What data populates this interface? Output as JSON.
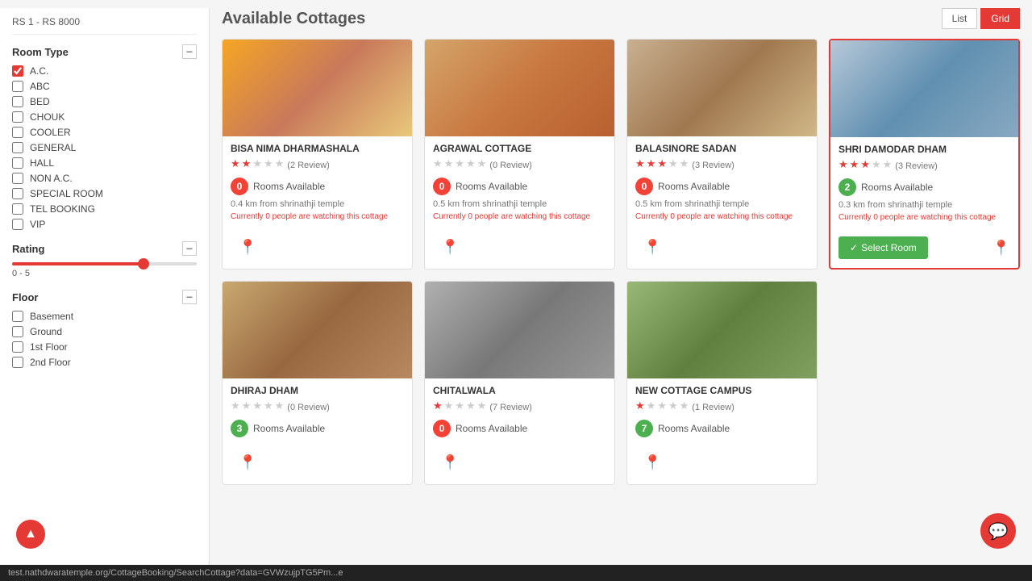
{
  "sidebar": {
    "price_range": "RS 1 - RS 8000",
    "room_type_label": "Room Type",
    "room_types": [
      {
        "id": "ac",
        "label": "A.C.",
        "checked": true
      },
      {
        "id": "abc",
        "label": "ABC",
        "checked": false
      },
      {
        "id": "bed",
        "label": "BED",
        "checked": false
      },
      {
        "id": "chouk",
        "label": "CHOUK",
        "checked": false
      },
      {
        "id": "cooler",
        "label": "COOLER",
        "checked": false
      },
      {
        "id": "general",
        "label": "GENERAL",
        "checked": false
      },
      {
        "id": "hall",
        "label": "HALL",
        "checked": false
      },
      {
        "id": "non_ac",
        "label": "NON A.C.",
        "checked": false
      },
      {
        "id": "special_room",
        "label": "SPECIAL ROOM",
        "checked": false
      },
      {
        "id": "tel_booking",
        "label": "TEL BOOKING",
        "checked": false
      },
      {
        "id": "vip",
        "label": "VIP",
        "checked": false
      }
    ],
    "rating_label": "Rating",
    "rating_range": "0 - 5",
    "floor_label": "Floor",
    "floor_types": [
      {
        "id": "basement",
        "label": "Basement",
        "checked": false
      },
      {
        "id": "ground",
        "label": "Ground",
        "checked": false
      },
      {
        "id": "first",
        "label": "1st Floor",
        "checked": false
      },
      {
        "id": "second",
        "label": "2nd Floor",
        "checked": false
      }
    ]
  },
  "main": {
    "title": "Available Cottages",
    "view_list_label": "List",
    "view_grid_label": "Grid"
  },
  "cottages": [
    {
      "id": "bisa",
      "name": "BISA NIMA DHARMASHALA",
      "stars": 2,
      "total_stars": 5,
      "review_count": "(2 Review)",
      "rooms_available": 0,
      "badge_class": "badge-zero",
      "rooms_label": "Rooms Available",
      "distance": "0.4 km from shrinathji temple",
      "watching": "Currently 0 people are watching this cottage",
      "img_class": "img-bisa",
      "highlighted": false,
      "show_select": false
    },
    {
      "id": "agrawal",
      "name": "AGRAWAL COTTAGE",
      "stars": 0,
      "total_stars": 5,
      "review_count": "(0 Review)",
      "rooms_available": 0,
      "badge_class": "badge-zero",
      "rooms_label": "Rooms Available",
      "distance": "0.5 km from shrinathji temple",
      "watching": "Currently 0 people are watching this cottage",
      "img_class": "img-agrawal",
      "highlighted": false,
      "show_select": false
    },
    {
      "id": "balasinore",
      "name": "BALASINORE SADAN",
      "stars": 3,
      "total_stars": 5,
      "review_count": "(3 Review)",
      "rooms_available": 0,
      "badge_class": "badge-zero",
      "rooms_label": "Rooms Available",
      "distance": "0.5 km from shrinathji temple",
      "watching": "Currently 0 people are watching this cottage",
      "img_class": "img-balasinore",
      "highlighted": false,
      "show_select": false
    },
    {
      "id": "shri",
      "name": "SHRI DAMODAR DHAM",
      "stars": 3,
      "total_stars": 5,
      "review_count": "(3 Review)",
      "rooms_available": 2,
      "badge_class": "badge-two",
      "rooms_label": "Rooms Available",
      "distance": "0.3 km from shrinathji temple",
      "watching": "Currently 0 people are watching this cottage",
      "img_class": "img-shri",
      "highlighted": true,
      "show_select": true,
      "select_btn_label": "Select Room"
    },
    {
      "id": "dhiraj",
      "name": "DHIRAJ DHAM",
      "stars": 0,
      "total_stars": 5,
      "review_count": "(0 Review)",
      "rooms_available": 3,
      "badge_class": "badge-three",
      "rooms_label": "Rooms Available",
      "distance": "",
      "watching": "",
      "img_class": "img-dhiraj",
      "highlighted": false,
      "show_select": false
    },
    {
      "id": "chital",
      "name": "CHITALWALA",
      "stars": 1,
      "total_stars": 5,
      "review_count": "(7 Review)",
      "rooms_available": 0,
      "badge_class": "badge-zero",
      "rooms_label": "Rooms Available",
      "distance": "",
      "watching": "",
      "img_class": "img-chital",
      "highlighted": false,
      "show_select": false
    },
    {
      "id": "new",
      "name": "NEW COTTAGE CAMPUS",
      "stars": 1,
      "total_stars": 5,
      "review_count": "(1 Review)",
      "rooms_available": 7,
      "badge_class": "badge-seven",
      "rooms_label": "Rooms Available",
      "distance": "",
      "watching": "",
      "img_class": "img-new",
      "highlighted": false,
      "show_select": false
    }
  ],
  "status_bar": {
    "url": "test.nathdwaratemple.org/CottageBooking/SearchCottage?data=GVWzujpTG5Pm...e"
  },
  "buttons": {
    "scroll_top": "▲",
    "chat": "💬",
    "select_room_icon": "✓"
  }
}
